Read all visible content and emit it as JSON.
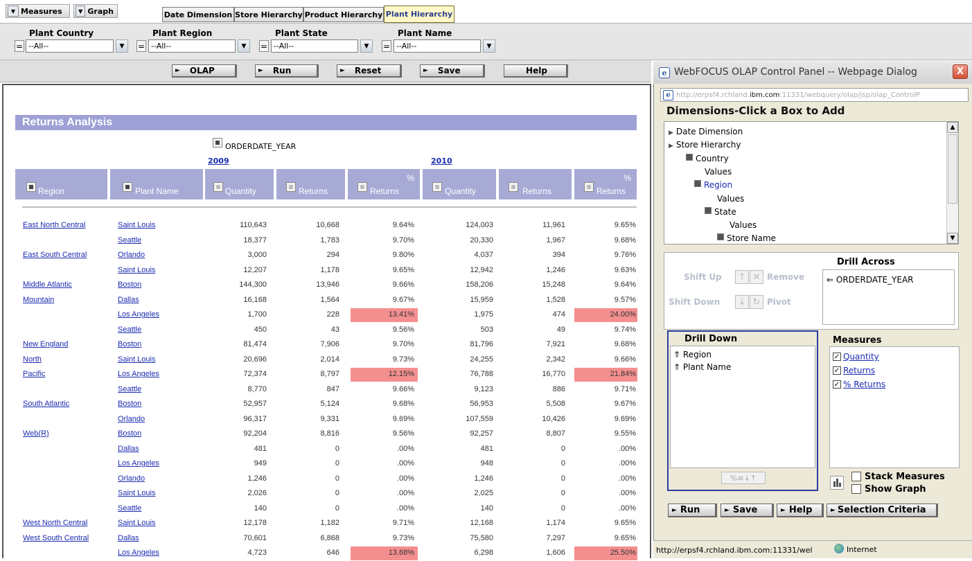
{
  "menu": {
    "measures": "Measures",
    "graph": "Graph"
  },
  "tabs": [
    {
      "label": "Date Dimension"
    },
    {
      "label": "Store Hierarchy"
    },
    {
      "label": "Product Hierarchy"
    },
    {
      "label": "Plant Hierarchy",
      "active": true
    }
  ],
  "filters": [
    {
      "label": "Plant Country",
      "op": "=",
      "value": "--All--"
    },
    {
      "label": "Plant Region",
      "op": "=",
      "value": "--All--"
    },
    {
      "label": "Plant State",
      "op": "=",
      "value": "--All--"
    },
    {
      "label": "Plant Name",
      "op": "=",
      "value": "--All--"
    }
  ],
  "toolbar": {
    "olap": "OLAP",
    "run": "Run",
    "reset": "Reset",
    "save": "Save",
    "help": "Help"
  },
  "report": {
    "title": "Returns Analysis",
    "across": "ORDERDATE_YEAR",
    "years": [
      "2009",
      "2010"
    ],
    "headers": {
      "region": "Region",
      "plant": "Plant Name",
      "qty": "Quantity",
      "returns": "Returns",
      "pct": "%",
      "pct_returns": "Returns"
    },
    "rows": [
      {
        "region": "East North Central",
        "plant": "Saint Louis",
        "v": [
          "110,643",
          "10,668",
          "9.64%",
          "124,003",
          "11,961",
          "9.65%"
        ],
        "h": [
          false,
          false
        ]
      },
      {
        "region": "",
        "plant": "Seattle",
        "v": [
          "18,377",
          "1,783",
          "9.70%",
          "20,330",
          "1,967",
          "9.68%"
        ],
        "h": [
          false,
          false
        ]
      },
      {
        "region": "East South Central",
        "plant": "Orlando",
        "v": [
          "3,000",
          "294",
          "9.80%",
          "4,037",
          "394",
          "9.76%"
        ],
        "h": [
          false,
          false
        ]
      },
      {
        "region": "",
        "plant": "Saint Louis",
        "v": [
          "12,207",
          "1,178",
          "9.65%",
          "12,942",
          "1,246",
          "9.63%"
        ],
        "h": [
          false,
          false
        ]
      },
      {
        "region": "Middle Atlantic",
        "plant": "Boston",
        "v": [
          "144,300",
          "13,946",
          "9.66%",
          "158,206",
          "15,248",
          "9.64%"
        ],
        "h": [
          false,
          false
        ]
      },
      {
        "region": "Mountain",
        "plant": "Dallas",
        "v": [
          "16,168",
          "1,564",
          "9.67%",
          "15,959",
          "1,528",
          "9.57%"
        ],
        "h": [
          false,
          false
        ]
      },
      {
        "region": "",
        "plant": "Los Angeles",
        "v": [
          "1,700",
          "228",
          "13.41%",
          "1,975",
          "474",
          "24.00%"
        ],
        "h": [
          true,
          true
        ]
      },
      {
        "region": "",
        "plant": "Seattle",
        "v": [
          "450",
          "43",
          "9.56%",
          "503",
          "49",
          "9.74%"
        ],
        "h": [
          false,
          false
        ]
      },
      {
        "region": "New England",
        "plant": "Boston",
        "v": [
          "81,474",
          "7,906",
          "9.70%",
          "81,796",
          "7,921",
          "9.68%"
        ],
        "h": [
          false,
          false
        ]
      },
      {
        "region": "North",
        "plant": "Saint Louis",
        "v": [
          "20,696",
          "2,014",
          "9.73%",
          "24,255",
          "2,342",
          "9.66%"
        ],
        "h": [
          false,
          false
        ]
      },
      {
        "region": "Pacific",
        "plant": "Los Angeles",
        "v": [
          "72,374",
          "8,797",
          "12.15%",
          "76,788",
          "16,770",
          "21.84%"
        ],
        "h": [
          true,
          true
        ]
      },
      {
        "region": "",
        "plant": "Seattle",
        "v": [
          "8,770",
          "847",
          "9.66%",
          "9,123",
          "886",
          "9.71%"
        ],
        "h": [
          false,
          false
        ]
      },
      {
        "region": "South Atlantic",
        "plant": "Boston",
        "v": [
          "52,957",
          "5,124",
          "9.68%",
          "56,953",
          "5,508",
          "9.67%"
        ],
        "h": [
          false,
          false
        ]
      },
      {
        "region": "",
        "plant": "Orlando",
        "v": [
          "96,317",
          "9,331",
          "9.69%",
          "107,559",
          "10,426",
          "9.69%"
        ],
        "h": [
          false,
          false
        ]
      },
      {
        "region": "Web(R)",
        "plant": "Boston",
        "v": [
          "92,204",
          "8,816",
          "9.56%",
          "92,257",
          "8,807",
          "9.55%"
        ],
        "h": [
          false,
          false
        ]
      },
      {
        "region": "",
        "plant": "Dallas",
        "v": [
          "481",
          "0",
          ".00%",
          "481",
          "0",
          ".00%"
        ],
        "h": [
          false,
          false
        ]
      },
      {
        "region": "",
        "plant": "Los Angeles",
        "v": [
          "949",
          "0",
          ".00%",
          "948",
          "0",
          ".00%"
        ],
        "h": [
          false,
          false
        ]
      },
      {
        "region": "",
        "plant": "Orlando",
        "v": [
          "1,246",
          "0",
          ".00%",
          "1,246",
          "0",
          ".00%"
        ],
        "h": [
          false,
          false
        ]
      },
      {
        "region": "",
        "plant": "Saint Louis",
        "v": [
          "2,026",
          "0",
          ".00%",
          "2,025",
          "0",
          ".00%"
        ],
        "h": [
          false,
          false
        ]
      },
      {
        "region": "",
        "plant": "Seattle",
        "v": [
          "140",
          "0",
          ".00%",
          "140",
          "0",
          ".00%"
        ],
        "h": [
          false,
          false
        ]
      },
      {
        "region": "West North Central",
        "plant": "Saint Louis",
        "v": [
          "12,178",
          "1,182",
          "9.71%",
          "12,168",
          "1,174",
          "9.65%"
        ],
        "h": [
          false,
          false
        ]
      },
      {
        "region": "West South Central",
        "plant": "Dallas",
        "v": [
          "70,601",
          "6,868",
          "9.73%",
          "75,580",
          "7,297",
          "9.65%"
        ],
        "h": [
          false,
          false
        ]
      },
      {
        "region": "",
        "plant": "Los Angeles",
        "v": [
          "4,723",
          "646",
          "13.68%",
          "6,298",
          "1,606",
          "25.50%"
        ],
        "h": [
          true,
          true
        ]
      }
    ]
  },
  "dialog": {
    "title": "WebFOCUS OLAP Control Panel -- Webpage Dialog",
    "close": "X",
    "url_prefix": "http://erpsf4.rchland.",
    "url_host": "ibm.com",
    "url_rest": ":11331/webquery/olap/jsp/olap_ControlP",
    "dim_heading": "Dimensions-Click a Box to Add",
    "tree": [
      {
        "label": "Date Dimension",
        "marker": "tri"
      },
      {
        "label": "Store Hierarchy",
        "marker": "tri"
      },
      {
        "label": "Country",
        "marker": "box"
      },
      {
        "label": "Values",
        "marker": ""
      },
      {
        "label": "Region",
        "marker": "box",
        "link": true
      },
      {
        "label": "Values",
        "marker": ""
      },
      {
        "label": "State",
        "marker": "box"
      },
      {
        "label": "Values",
        "marker": ""
      },
      {
        "label": "Store Name",
        "marker": "box"
      }
    ],
    "controls": {
      "shift_up": "Shift Up",
      "remove": "Remove",
      "shift_down": "Shift Down",
      "pivot": "Pivot"
    },
    "drill_across": {
      "title": "Drill Across",
      "items": [
        "ORDERDATE_YEAR"
      ]
    },
    "drill_down": {
      "title": "Drill Down",
      "items": [
        "Region",
        "Plant Name"
      ]
    },
    "measures": {
      "title": "Measures",
      "items": [
        "Quantity",
        "Returns",
        "% Returns"
      ]
    },
    "stack_measures": "Stack Measures",
    "show_graph": "Show Graph",
    "small_sort_label": "%≡↓↑",
    "buttons": {
      "run": "Run",
      "save": "Save",
      "help": "Help",
      "selection": "Selection Criteria"
    },
    "status_url": "http://erpsf4.rchland.ibm.com:11331/wel",
    "status_zone": "Internet"
  }
}
